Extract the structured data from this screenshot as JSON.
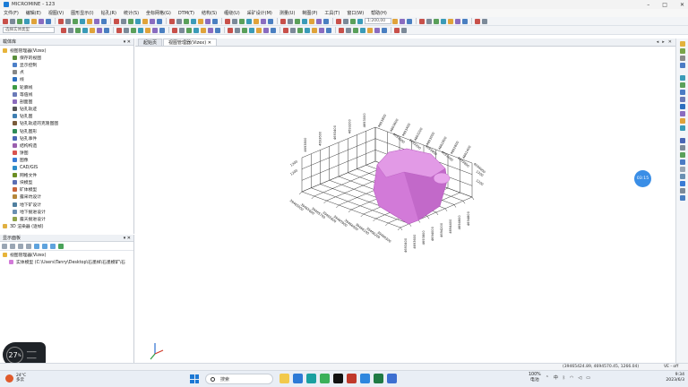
{
  "window": {
    "title": "MICROMINE - 123",
    "controls": [
      "–",
      "□",
      "✕"
    ]
  },
  "menu": [
    "文件(F)",
    "编辑(E)",
    "视图(V)",
    "图形显示(I)",
    "钻孔(R)",
    "统计(S)",
    "坐标网格(G)",
    "DTM(T)",
    "结构(S)",
    "缠绕(U)",
    "采矿设计(M)",
    "测量(U)",
    "制图(P)",
    "工具(T)",
    "窗口(W)",
    "帮助(H)"
  ],
  "toolbar": {
    "scale_value": "1:200,00",
    "search_placeholder": "选择实体类型"
  },
  "left_panel": {
    "title": "载体库",
    "items": [
      {
        "label": "视图管理器(Vizex)",
        "color": "#e7b43a"
      },
      {
        "label": "保存的视图",
        "color": "#5a8f3c"
      },
      {
        "label": "显示控制",
        "color": "#4c7fc8"
      },
      {
        "label": "点",
        "color": "#888888"
      },
      {
        "label": "线",
        "color": "#2d6fbf"
      },
      {
        "label": "轮廓线",
        "color": "#3d9a44"
      },
      {
        "label": "等值线",
        "color": "#6a7ab8"
      },
      {
        "label": "剖面图",
        "color": "#8c6bbd"
      },
      {
        "label": "钻孔轨迹",
        "color": "#555555"
      },
      {
        "label": "钻孔图",
        "color": "#3f7fb2"
      },
      {
        "label": "钻孔轨迹的克隆图图",
        "color": "#7a5c3a"
      },
      {
        "label": "钻孔图形",
        "color": "#2e8b57"
      },
      {
        "label": "钻孔事件",
        "color": "#4a66b5"
      },
      {
        "label": "结构构造",
        "color": "#9b5fae"
      },
      {
        "label": "饼图",
        "color": "#d9534f"
      },
      {
        "label": "图像",
        "color": "#3a7bd5"
      },
      {
        "label": "CAD/GIS",
        "color": "#2d8cc8"
      },
      {
        "label": "网格文件",
        "color": "#6b8e23"
      },
      {
        "label": "块模型",
        "color": "#5b6fb5"
      },
      {
        "label": "矿体模型",
        "color": "#c9633a"
      },
      {
        "label": "露采坑设计",
        "color": "#b5873a"
      },
      {
        "label": "地下矿设计",
        "color": "#4f7f9f"
      },
      {
        "label": "地下掘进设计",
        "color": "#6a8fb2"
      },
      {
        "label": "露天掘进设计",
        "color": "#8fa34a"
      },
      {
        "label": "3D 渲染器 (逐帧)",
        "color": "#e0b040"
      }
    ],
    "display_panel": {
      "title": "显示面板",
      "root": "视图管理器(Vizex)",
      "item": "实体模型 (C:\\Users\\Tanry\\Desktop\\石墨样\\石墨模矿\\石"
    }
  },
  "tabs": [
    {
      "label": "起始页",
      "active": false
    },
    {
      "label": "视图管理器(Vizex)",
      "active": true
    }
  ],
  "grid_labels": {
    "top_left": [
      "4693800",
      "4693600",
      "4693400",
      "4693200",
      "4693000"
    ],
    "top_right": [
      "4693000",
      "4693200",
      "4693400",
      "4693600",
      "4693800",
      "4694000"
    ],
    "top_mid": [
      "4693800",
      "4693600",
      "4693400",
      "4693200",
      "4693000",
      "4692800",
      "4692600",
      "4692400"
    ],
    "bottom_left": [
      "39465500",
      "39465600",
      "39465700",
      "39465800",
      "39465900",
      "39466000",
      "39466100",
      "39466200",
      "39466300"
    ],
    "bottom_right": [
      "4693400",
      "4693600",
      "4693800",
      "4694000",
      "4694200",
      "4694400",
      "4694600",
      "4694800"
    ],
    "left_z": [
      "1300",
      "1200"
    ],
    "right_z": [
      "1300",
      "1200"
    ]
  },
  "status": {
    "coords": "(39465424.89, 4694570.45, 1266.04)",
    "scale": "VE - off"
  },
  "bubble": "03:15",
  "overlay": {
    "value": "27",
    "unit": "%",
    "lines": [
      "━━━━━",
      "━━━━━"
    ]
  },
  "taskbar": {
    "weather_temp": "24°C",
    "weather_desc": "多云",
    "search": "搜索",
    "tray_zoom": "100%",
    "tray_zoom_label": "电池",
    "lang_top": "中",
    "time": "9:34",
    "date": "2023/6/3"
  },
  "colors": {
    "model": "#d27ad8",
    "model_dark": "#b55bbd",
    "grid": "#3a3a3a",
    "accent": "#1c78d4"
  }
}
